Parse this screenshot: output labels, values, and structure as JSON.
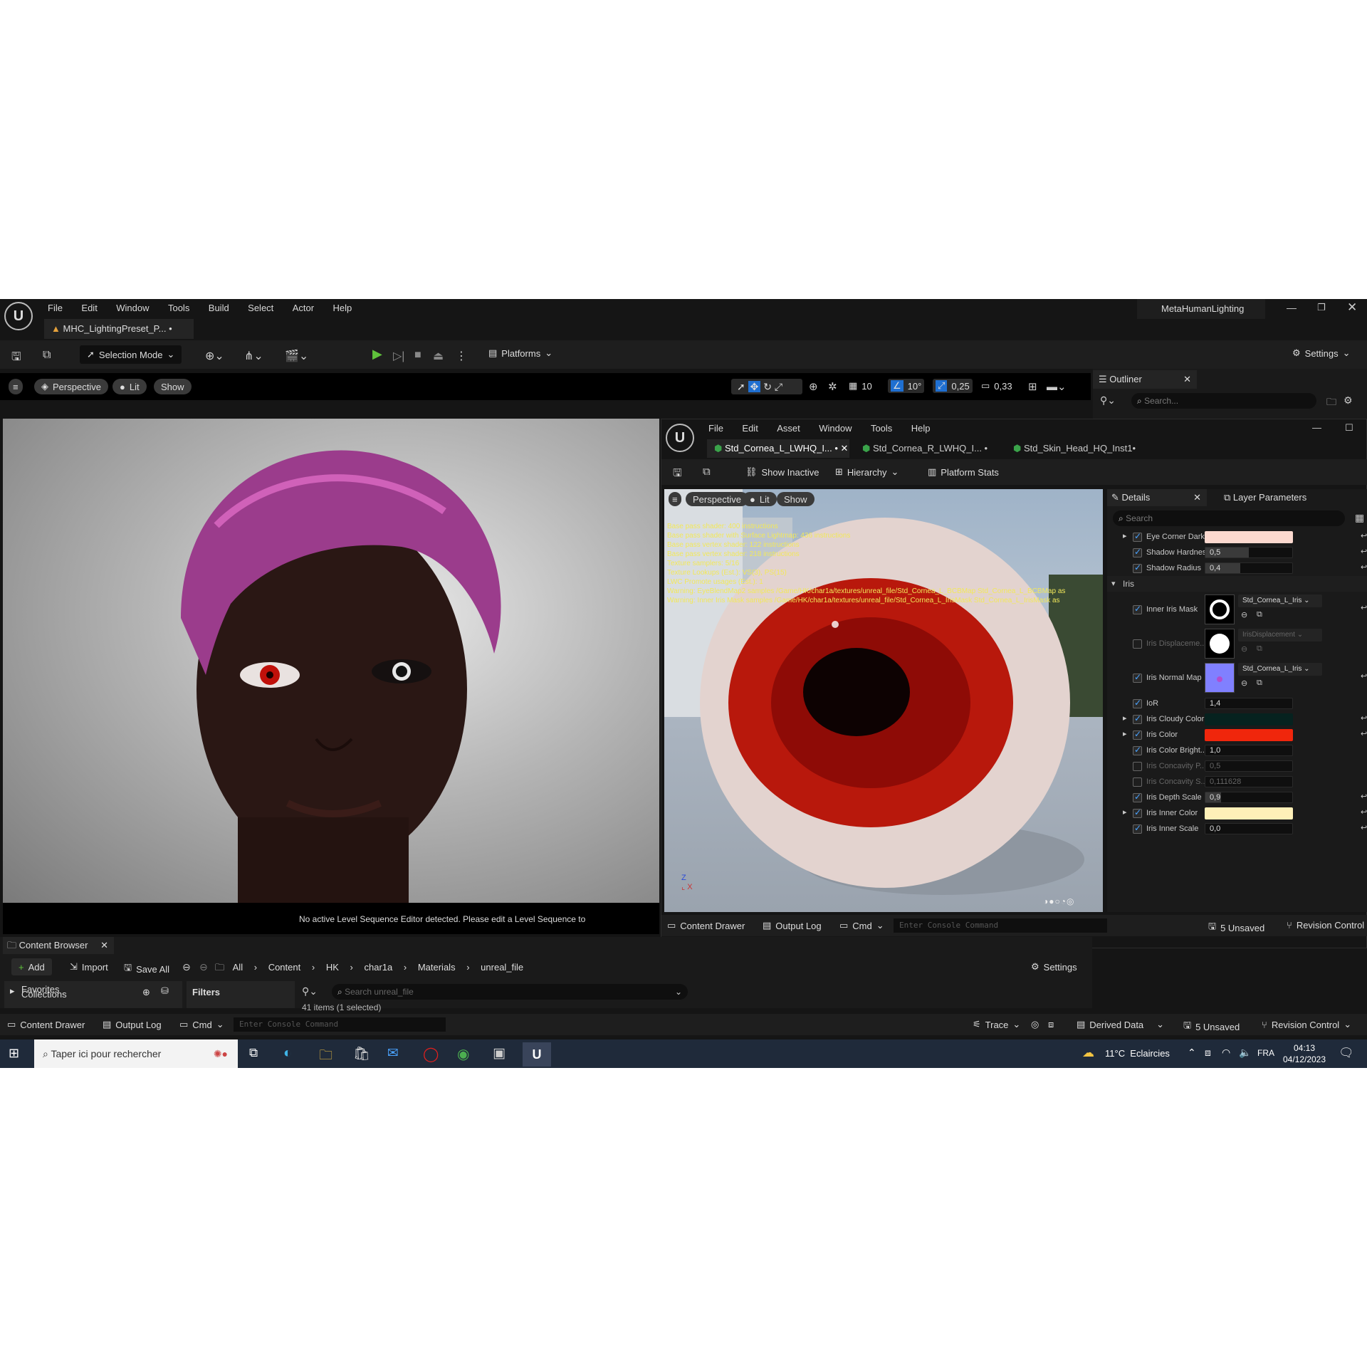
{
  "main": {
    "menu": [
      "File",
      "Edit",
      "Window",
      "Tools",
      "Build",
      "Select",
      "Actor",
      "Help"
    ],
    "project_name": "MetaHumanLighting",
    "level_tab": "MHC_LightingPreset_P...",
    "toolbar": {
      "selection_mode": "Selection Mode",
      "platforms": "Platforms",
      "settings": "Settings"
    },
    "viewport": {
      "perspective": "Perspective",
      "lit": "Lit",
      "show": "Show",
      "grid_snap": "10",
      "rot_snap": "10°",
      "scale_snap": "0,25",
      "cam_speed": "0,33",
      "status_msg": "No active Level Sequence Editor detected. Please edit a Level Sequence to"
    },
    "outliner": {
      "title": "Outliner",
      "search_placeholder": "Search..."
    }
  },
  "material_editor": {
    "menu": [
      "File",
      "Edit",
      "Asset",
      "Window",
      "Tools",
      "Help"
    ],
    "tabs": [
      "Std_Cornea_L_LWHQ_I...",
      "Std_Cornea_R_LWHQ_I...",
      "Std_Skin_Head_HQ_Inst1"
    ],
    "toolbar": {
      "show_inactive": "Show Inactive",
      "hierarchy": "Hierarchy",
      "platform_stats": "Platform Stats"
    },
    "viewport": {
      "perspective": "Perspective",
      "lit": "Lit",
      "show": "Show",
      "stats": [
        "Base pass shader: 400 instructions",
        "Base pass shader with Surface Lightmap: 436 instructions",
        "Base pass vertex shader: 122 instructions",
        "Base pass vertex shader: 218 instructions",
        "Texture samplers: 5/16",
        "Texture Lookups (Est.): VS(3), PS(15)",
        "LWC Promote usages (Est.): 1",
        "Warning: EyeBlendMap2 samples /Game/HK/char1a/textures/unreal_file/Std_Cornea_L_BCBMap Std_Cornea_L_BCBMap as",
        "Warning: Inner Iris Mask samples /Game/HK/char1a/textures/unreal_file/Std_Cornea_L_IrisMask Std_Cornea_L_IrisMask as"
      ]
    },
    "details": {
      "title": "Details",
      "layer_params": "Layer Parameters",
      "search_placeholder": "Search",
      "iris_section": "Iris",
      "eye_corner": "Eye Corner Dark...",
      "eye_corner_color": "#fcd9cf",
      "shadow_hardness": {
        "label": "Shadow Hardness",
        "value": "0,5",
        "level": 0.5
      },
      "shadow_radius": {
        "label": "Shadow Radius",
        "value": "0,4",
        "level": 0.4
      },
      "inner_iris_mask": {
        "label": "Inner Iris Mask",
        "texture": "Std_Cornea_L_Iris"
      },
      "iris_displacement": {
        "label": "Iris Displaceme...",
        "texture": "IrisDisplacement"
      },
      "iris_normal_map": {
        "label": "Iris Normal Map",
        "texture": "Std_Cornea_L_Iris"
      },
      "ior": {
        "label": "IoR",
        "value": "1,4"
      },
      "iris_cloudy_color": {
        "label": "Iris Cloudy Color",
        "color": "#06221f"
      },
      "iris_color": {
        "label": "Iris Color",
        "color": "#f0260c"
      },
      "iris_color_bright": {
        "label": "Iris Color Bright...",
        "value": "1,0"
      },
      "iris_concavity_p": {
        "label": "Iris Concavity P...",
        "value": "0,5"
      },
      "iris_concavity_s": {
        "label": "Iris Concavity S...",
        "value": "0,111628"
      },
      "iris_depth_scale": {
        "label": "Iris Depth Scale",
        "value": "0,9",
        "level": 0.18
      },
      "iris_inner_color": {
        "label": "Iris Inner Color",
        "color": "#fff0b8"
      },
      "iris_inner_scale": {
        "label": "Iris Inner Scale",
        "value": "0,0"
      }
    },
    "bottom": {
      "content_drawer": "Content Drawer",
      "output_log": "Output Log",
      "cmd": "Cmd",
      "console_placeholder": "Enter Console Command",
      "unsaved": "5 Unsaved",
      "revision": "Revision Control"
    }
  },
  "content_browser": {
    "title": "Content Browser",
    "add": "Add",
    "import": "Import",
    "save_all": "Save All",
    "breadcrumb": [
      "All",
      "Content",
      "HK",
      "char1a",
      "Materials",
      "unreal_file"
    ],
    "settings": "Settings",
    "favorites": "Favorites",
    "collections": "Collections",
    "filters": "Filters",
    "search_placeholder": "Search unreal_file",
    "items_count": "41 items (1 selected)"
  },
  "status_bar": {
    "content_drawer": "Content Drawer",
    "output_log": "Output Log",
    "cmd": "Cmd",
    "console_placeholder": "Enter Console Command",
    "trace": "Trace",
    "derived_data": "Derived Data",
    "unsaved": "5 Unsaved",
    "revision": "Revision Control"
  },
  "taskbar": {
    "search_placeholder": "Taper ici pour rechercher",
    "weather": "11°C  Eclaircies",
    "lang": "FRA",
    "time": "04:13",
    "date": "04/12/2023"
  }
}
